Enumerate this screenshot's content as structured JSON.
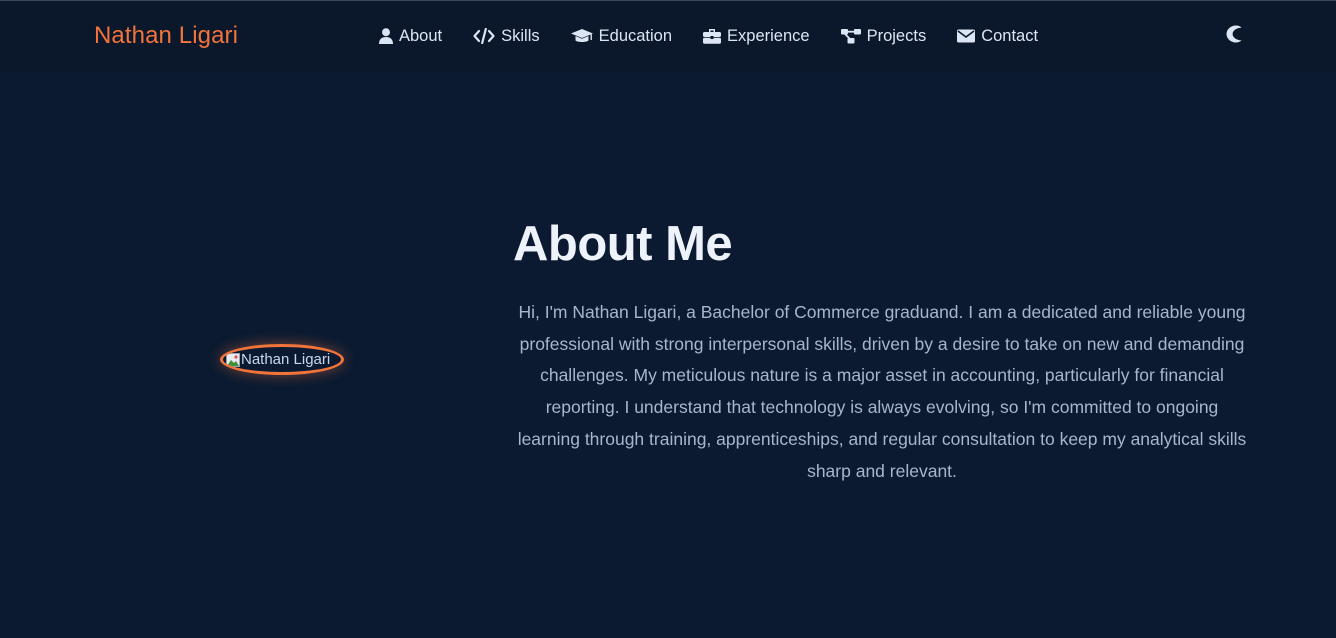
{
  "navbar": {
    "brand": "Nathan Ligari",
    "links": [
      {
        "label": "About",
        "icon": "user-icon"
      },
      {
        "label": "Skills",
        "icon": "code-icon"
      },
      {
        "label": "Education",
        "icon": "graduation-cap-icon"
      },
      {
        "label": "Experience",
        "icon": "briefcase-icon"
      },
      {
        "label": "Projects",
        "icon": "sitemap-icon"
      },
      {
        "label": "Contact",
        "icon": "envelope-icon"
      }
    ],
    "theme_toggle_icon": "moon-icon"
  },
  "about": {
    "photo_alt": "Nathan Ligari",
    "title": "About Me",
    "description": "Hi, I'm Nathan Ligari, a Bachelor of Commerce graduand. I am a dedicated and reliable young professional with strong interpersonal skills, driven by a desire to take on new and demanding challenges. My meticulous nature is a major asset in accounting, particularly for financial reporting. I understand that technology is always evolving, so I'm committed to ongoing learning through training, apprenticeships, and regular consultation to keep my analytical skills sharp and relevant."
  },
  "colors": {
    "accent": "#f2743b",
    "background": "#0b1a30",
    "navbar_background": "#0b172a",
    "heading": "#eef3fb",
    "nav_text": "#dce5f3",
    "body_text": "#a8b5ca"
  }
}
